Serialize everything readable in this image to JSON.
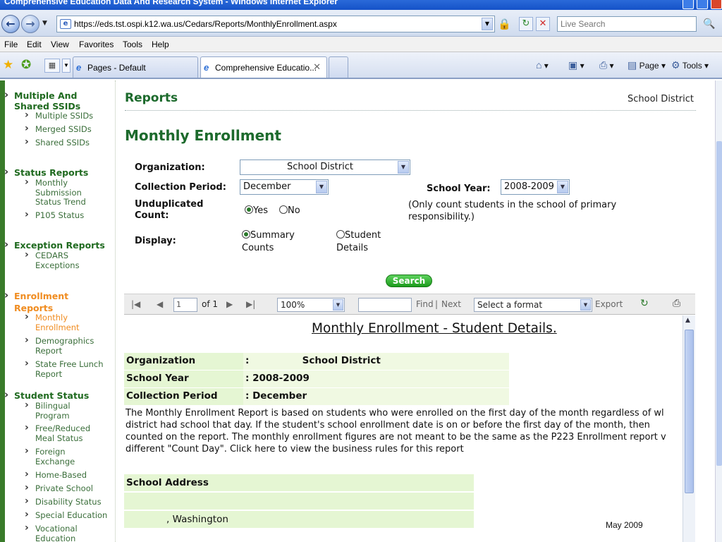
{
  "window": {
    "title": "Comprehensive Education Data And Research System - Windows Internet Explorer"
  },
  "address": {
    "url": "https://eds.tst.ospi.k12.wa.us/Cedars/Reports/MonthlyEnrollment.aspx",
    "search_placeholder": "Live Search"
  },
  "menu": [
    "File",
    "Edit",
    "View",
    "Favorites",
    "Tools",
    "Help"
  ],
  "tabs": [
    {
      "label": "Pages - Default"
    },
    {
      "label": "Comprehensive Educatio..."
    }
  ],
  "commands": {
    "page": "Page",
    "tools": "Tools"
  },
  "sidebar": {
    "sections": [
      {
        "label": "Multiple And Shared SSIDs",
        "items": [
          "Multiple SSIDs",
          "Merged SSIDs",
          "Shared SSIDs"
        ]
      },
      {
        "label": "Status Reports",
        "items": [
          "Monthly Submission Status Trend",
          "P105 Status"
        ]
      },
      {
        "label": "Exception Reports",
        "items": [
          "CEDARS Exceptions"
        ]
      },
      {
        "label": "Enrollment Reports",
        "items": [
          "Monthly Enrollment",
          "Demographics Report",
          "State Free Lunch Report"
        ]
      },
      {
        "label": "Student Status",
        "items": [
          "Bilingual Program",
          "Free/Reduced Meal Status",
          "Foreign Exchange",
          "Home-Based",
          "Private School",
          "Disability Status",
          "Special Education",
          "Vocational Education"
        ]
      }
    ]
  },
  "header": {
    "reports": "Reports",
    "district": "School District"
  },
  "page": {
    "title": "Monthly Enrollment"
  },
  "form": {
    "organization_label": "Organization:",
    "organization_value": "School District",
    "collection_period_label": "Collection Period:",
    "collection_period_value": "December",
    "school_year_label": "School Year:",
    "school_year_value": "2008-2009",
    "unduplicated_label_1": "Unduplicated",
    "unduplicated_label_2": "Count:",
    "yes": "Yes",
    "no": "No",
    "note": "(Only count students in the school of primary responsibility.)",
    "display_label": "Display:",
    "summary_1": "Summary",
    "summary_2": "Counts",
    "student_1": "Student",
    "student_2": "Details",
    "search": "Search"
  },
  "toolbar": {
    "page_value": "1",
    "of": "of 1",
    "zoom": "100%",
    "find": "Find",
    "sep": "|",
    "next": "Next",
    "format": "Select a format",
    "export": "Export"
  },
  "report": {
    "title": "Monthly Enrollment - Student Details.",
    "org_label": "Organization",
    "org_value": ":                School District",
    "year_label": "School Year",
    "year_value": ": 2008-2009",
    "period_label": "Collection Period",
    "period_value": ": December",
    "desc_lines": [
      "The Monthly Enrollment Report is based on students who were enrolled on the first day of the month regardless of wl",
      "district had school that day. If the student's school enrollment date is on or before the first day of the month, then",
      "counted on the report. The monthly enrollment figures are not meant to be the same as the P223 Enrollment report v",
      "different \"Count Day\". Click here to view the business rules for this report"
    ],
    "address_label": "School Address",
    "address_city": ", Washington"
  },
  "footer": {
    "date": "May 2009"
  }
}
